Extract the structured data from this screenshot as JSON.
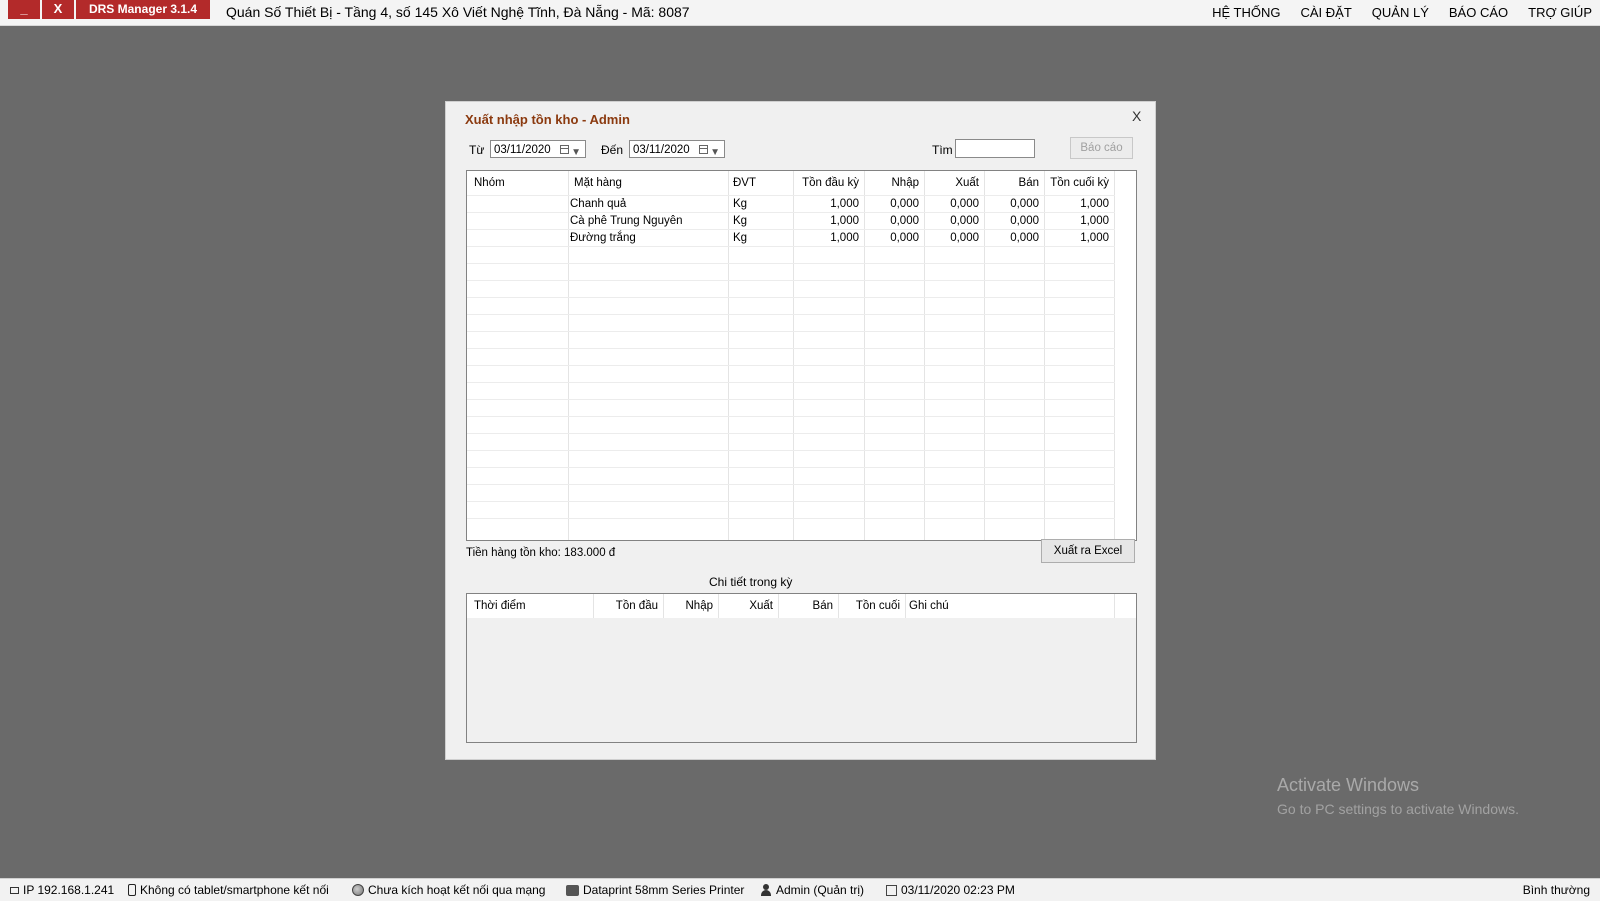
{
  "topbar": {
    "minimize": "_",
    "close": "X",
    "app_name": "DRS Manager 3.1.4",
    "store_info": "Quán Số Thiết Bị  -  Tầng 4, số 145 Xô Viết Nghệ Tĩnh, Đà Nẵng  -  Mã: 8087",
    "menu": [
      "HỆ THỐNG",
      "CÀI ĐẶT",
      "QUẢN LÝ",
      "BÁO CÁO",
      "TRỢ GIÚP"
    ]
  },
  "dialog": {
    "title": "Xuất nhập tồn kho - Admin",
    "close": "X",
    "from_label": "Từ",
    "from_date": "03/11/2020",
    "to_label": "Đến",
    "to_date": "03/11/2020",
    "search_label": "Tìm",
    "search_value": "",
    "report_button": "Báo cáo",
    "grid": {
      "columns": [
        "Nhóm",
        "Mặt hàng",
        "ĐVT",
        "Tồn đầu kỳ",
        "Nhập",
        "Xuất",
        "Bán",
        "Tồn cuối kỳ"
      ],
      "rows": [
        [
          "",
          "Chanh quả",
          "Kg",
          "1,000",
          "0,000",
          "0,000",
          "0,000",
          "1,000"
        ],
        [
          "",
          "Cà phê Trung Nguyên",
          "Kg",
          "1,000",
          "0,000",
          "0,000",
          "0,000",
          "1,000"
        ],
        [
          "",
          "Đường trắng",
          "Kg",
          "1,000",
          "0,000",
          "0,000",
          "0,000",
          "1,000"
        ]
      ]
    },
    "inventory_total": "Tiền hàng tồn kho: 183.000 đ",
    "export_button": "Xuất ra Excel",
    "detail_title": "Chi tiết trong kỳ",
    "detail_columns": [
      "Thời điểm",
      "Tồn đầu",
      "Nhập",
      "Xuất",
      "Bán",
      "Tồn cuối",
      "Ghi chú"
    ]
  },
  "watermark": {
    "line1": "Activate Windows",
    "line2": "Go to PC settings to activate Windows."
  },
  "statusbar": {
    "ip": "IP 192.168.1.241",
    "tablet": "Không có tablet/smartphone kết nối",
    "network": "Chưa kích hoạt kết nối qua mạng",
    "printer": "Dataprint 58mm Series Printer",
    "user": "Admin (Quản trị)",
    "datetime": "03/11/2020 02:23 PM",
    "mode": "Bình thường"
  }
}
